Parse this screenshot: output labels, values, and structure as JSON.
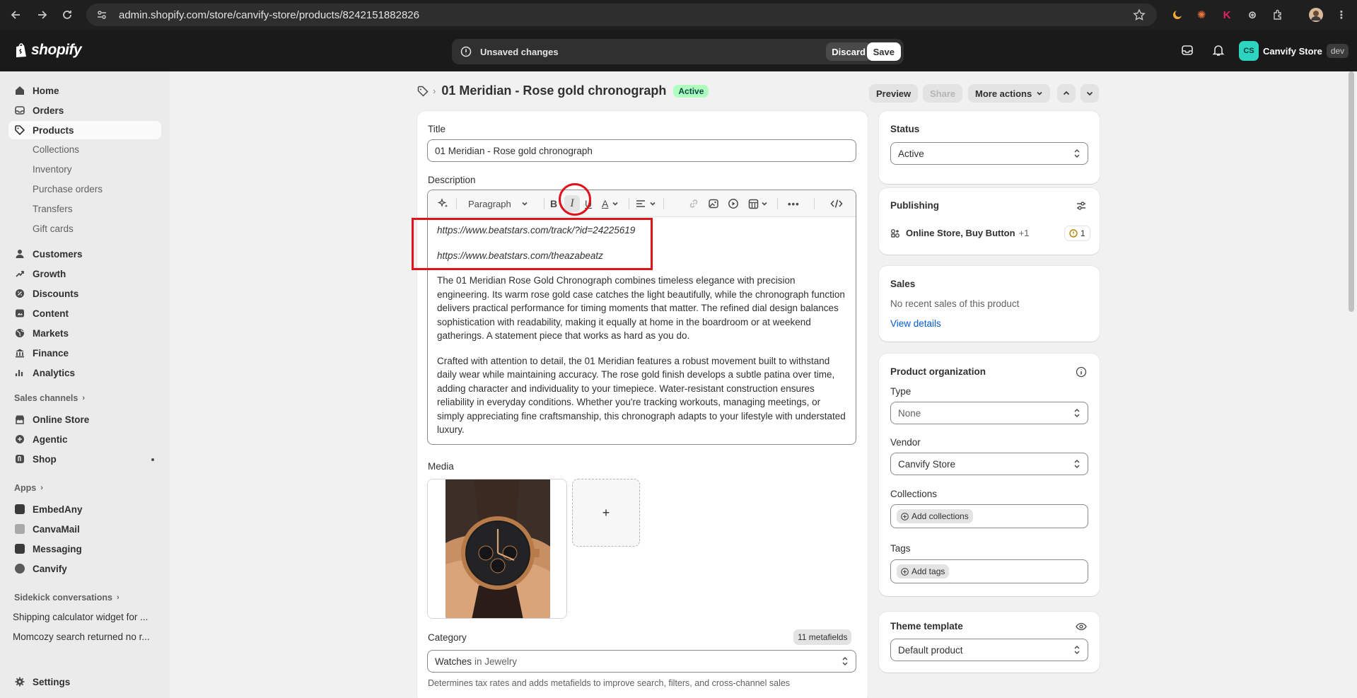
{
  "browser": {
    "url": "admin.shopify.com/store/canvify-store/products/8242151882826"
  },
  "topbar": {
    "brand": "shopify",
    "unsaved_text": "Unsaved changes",
    "discard_label": "Discard",
    "save_label": "Save",
    "store_initials": "CS",
    "store_name": "Canvify Store",
    "store_badge": "dev"
  },
  "sidebar": {
    "items": [
      {
        "label": "Home",
        "icon": "home-icon"
      },
      {
        "label": "Orders",
        "icon": "orders-icon"
      },
      {
        "label": "Products",
        "icon": "tag-icon"
      }
    ],
    "product_sub": [
      "Collections",
      "Inventory",
      "Purchase orders",
      "Transfers",
      "Gift cards"
    ],
    "items2": [
      {
        "label": "Customers",
        "icon": "person-icon"
      },
      {
        "label": "Growth",
        "icon": "growth-icon"
      },
      {
        "label": "Discounts",
        "icon": "discount-icon"
      },
      {
        "label": "Content",
        "icon": "content-icon"
      },
      {
        "label": "Markets",
        "icon": "globe-icon"
      },
      {
        "label": "Finance",
        "icon": "bank-icon"
      },
      {
        "label": "Analytics",
        "icon": "chart-icon"
      }
    ],
    "sales_channels_heading": "Sales channels",
    "channels": [
      "Online Store",
      "Agentic",
      "Shop"
    ],
    "apps_heading": "Apps",
    "apps": [
      "EmbedAny",
      "CanvaMail",
      "Messaging",
      "Canvify"
    ],
    "sidekick_heading": "Sidekick conversations",
    "conversations": [
      "Shipping calculator widget for ...",
      "Momcozy search returned no r..."
    ],
    "settings_label": "Settings"
  },
  "header": {
    "title": "01 Meridian - Rose gold chronograph",
    "status_badge": "Active",
    "preview_label": "Preview",
    "share_label": "Share",
    "more_actions_label": "More actions"
  },
  "main": {
    "title_label": "Title",
    "title_value": "01 Meridian - Rose gold chronograph",
    "description_label": "Description",
    "paragraph_select": "Paragraph",
    "link1": "https://www.beatstars.com/track/?id=24225619",
    "link2": "https://www.beatstars.com/theazabeatz",
    "para1": "The 01 Meridian Rose Gold Chronograph combines timeless elegance with precision engineering. Its warm rose gold case catches the light beautifully, while the chronograph function delivers practical performance for timing moments that matter. The refined dial design balances sophistication with readability, making it equally at home in the boardroom or at weekend gatherings. A statement piece that works as hard as you do.",
    "para2": "Crafted with attention to detail, the 01 Meridian features a robust movement built to withstand daily wear while maintaining accuracy. The rose gold finish develops a subtle patina over time, adding character and individuality to your timepiece. Water-resistant construction ensures reliability in everyday conditions. Whether you're tracking workouts, managing meetings, or simply appreciating fine craftsmanship, this chronograph adapts to your lifestyle with understated luxury.",
    "media_label": "Media",
    "media_add": "+",
    "category_label": "Category",
    "metafields_badge": "11 metafields",
    "category_value": "Watches",
    "category_in": "in Jewelry",
    "category_help": "Determines tax rates and adds metafields to improve search, filters, and cross-channel sales"
  },
  "right": {
    "status_label": "Status",
    "status_value": "Active",
    "publishing_title": "Publishing",
    "publishing_channels": "Online Store, Buy Button",
    "publishing_more": "+1",
    "publishing_issue_count": "1",
    "sales_title": "Sales",
    "sales_text": "No recent sales of this product",
    "view_details": "View details",
    "org_title": "Product organization",
    "type_label": "Type",
    "type_value": "None",
    "vendor_label": "Vendor",
    "vendor_value": "Canvify Store",
    "collections_label": "Collections",
    "add_collections": "Add collections",
    "tags_label": "Tags",
    "add_tags": "Add tags",
    "theme_title": "Theme template",
    "theme_value": "Default product"
  },
  "colors": {
    "accent_link": "#005bd3",
    "badge_green": "#affebf",
    "annotation_red": "#e0121c"
  }
}
